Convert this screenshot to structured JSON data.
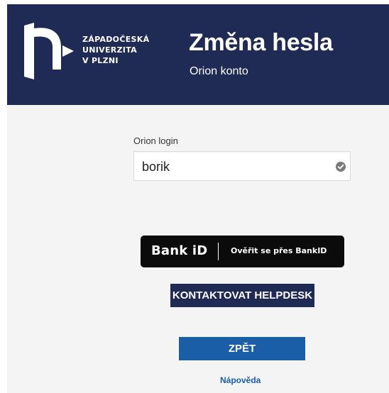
{
  "header": {
    "university_lines": [
      "ZÁPADOČESKÁ",
      "UNIVERZITA",
      "V PLZNI"
    ],
    "title": "Změna hesla",
    "subtitle": "Orion konto",
    "logo_icon": "zcu-logo-icon"
  },
  "form": {
    "login_label": "Orion login",
    "login_value": "borik",
    "validation_icon": "check-circle-icon"
  },
  "actions": {
    "bankid_logo": "Bank iD",
    "bankid_label": "Ověřit se přes BankID",
    "helpdesk_label": "KONTAKTOVAT HELPDESK",
    "back_label": "ZPĚT",
    "help_link": "Nápověda"
  },
  "colors": {
    "header_bg": "#1f2b55",
    "page_bg": "#f4f4f4",
    "helpdesk_button": "#1f2b55",
    "back_button": "#1a5ea8",
    "link": "#1a5ea8",
    "bankid_bg": "#0b0b0b"
  }
}
